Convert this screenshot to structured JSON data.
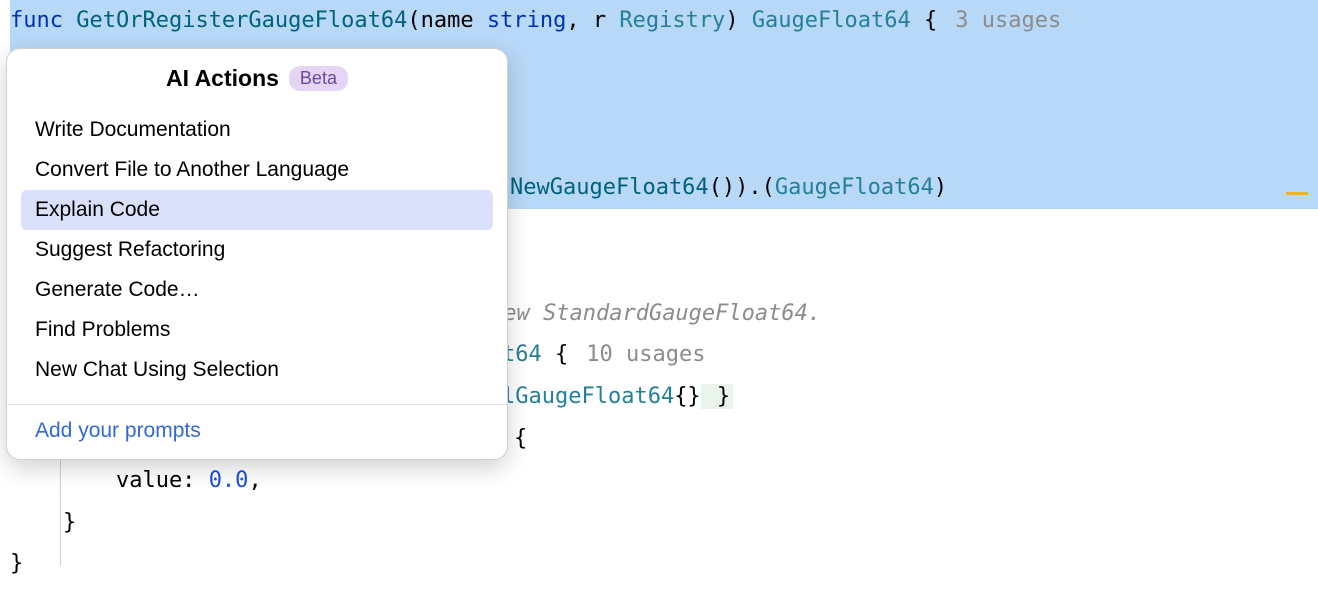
{
  "code": {
    "line1": {
      "func": "func ",
      "name": "GetOrRegisterGaugeFloat64",
      "params_open": "(",
      "param1": "name ",
      "param1_type": "string",
      "comma": ", ",
      "param2": "r ",
      "param2_type": "Registry",
      "params_close": ") ",
      "return_type": "GaugeFloat64",
      "brace": " {",
      "usages": "3 usages"
    },
    "line5": {
      "prefix": "  ",
      "func": "NewGaugeFloat64",
      "call": "()).(",
      "type": "GaugeFloat64",
      "close": ")"
    },
    "line8": {
      "comment_prefix": "new ",
      "comment_type": "StandardGaugeFloat64",
      "comment_suffix": "."
    },
    "line9": {
      "type_suffix": "t64",
      "brace": " {",
      "usages": "10 usages"
    },
    "line10": {
      "type": "lGaugeFloat64",
      "init": "{}",
      "close": " }"
    },
    "line11": {
      "brace": "{"
    },
    "line12": {
      "indent": "        value: ",
      "value": "0.0",
      "comma": ","
    },
    "line13": {
      "indent": "    }"
    },
    "line14": {
      "close": "}"
    }
  },
  "popup": {
    "title": "AI Actions",
    "badge": "Beta",
    "items": [
      "Write Documentation",
      "Convert File to Another Language",
      "Explain Code",
      "Suggest Refactoring",
      "Generate Code…",
      "Find Problems",
      "New Chat Using Selection"
    ],
    "footer": "Add your prompts"
  }
}
